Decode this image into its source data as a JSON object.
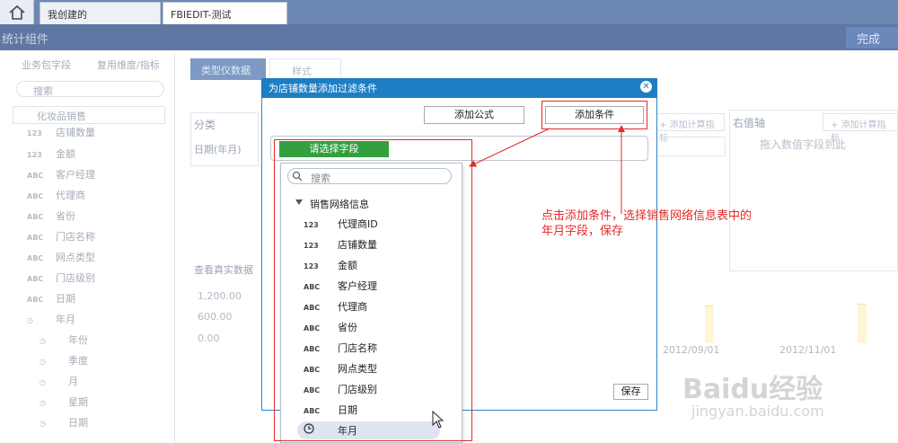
{
  "tabs": {
    "home_icon": "home-icon",
    "tab1": "我创建的",
    "tab2": "FBIEDIT-测试"
  },
  "header": {
    "title": "统计组件",
    "done": "完成"
  },
  "left_panel": {
    "tab_business": "业务包字段",
    "tab_reuse": "复用维度/指标",
    "search_placeholder": "搜索",
    "package": "化妆品销售",
    "fields": [
      {
        "type": "123",
        "label": "店铺数量"
      },
      {
        "type": "123",
        "label": "金额"
      },
      {
        "type": "ABC",
        "label": "客户经理"
      },
      {
        "type": "ABC",
        "label": "代理商"
      },
      {
        "type": "ABC",
        "label": "省份"
      },
      {
        "type": "ABC",
        "label": "门店名称"
      },
      {
        "type": "ABC",
        "label": "网点类型"
      },
      {
        "type": "ABC",
        "label": "门店级别"
      },
      {
        "type": "ABC",
        "label": "日期"
      },
      {
        "type": "clock",
        "label": "年月"
      }
    ],
    "date_children": [
      "年份",
      "季度",
      "月",
      "星期",
      "日期"
    ]
  },
  "main": {
    "tab_type": "类型仪数据",
    "tab_style": "样式",
    "category_label": "分类",
    "date_field": "日期(年月)",
    "check_label": "查看真实数据",
    "y_ticks": [
      "1,200.00",
      "600.00",
      "0.00"
    ],
    "x_ticks": [
      "2012/09/01",
      "2012/11/01"
    ],
    "right_axis_label": "右值轴",
    "right_axis_btn": "+ 添加计算指标",
    "mid_btn": "+ 添加计算指标",
    "drop_hint": "拖入数值字段到此"
  },
  "dialog": {
    "title": "为店铺数量添加过滤条件",
    "add_formula": "添加公式",
    "add_condition": "添加条件",
    "select_field": "请选择字段",
    "save": "保存",
    "search_placeholder": "搜索",
    "group": "销售网络信息",
    "fields": [
      {
        "type": "123",
        "label": "代理商ID"
      },
      {
        "type": "123",
        "label": "店铺数量"
      },
      {
        "type": "123",
        "label": "金额"
      },
      {
        "type": "ABC",
        "label": "客户经理"
      },
      {
        "type": "ABC",
        "label": "代理商"
      },
      {
        "type": "ABC",
        "label": "省份"
      },
      {
        "type": "ABC",
        "label": "门店名称"
      },
      {
        "type": "ABC",
        "label": "网点类型"
      },
      {
        "type": "ABC",
        "label": "门店级别"
      },
      {
        "type": "ABC",
        "label": "日期"
      },
      {
        "type": "clock",
        "label": "年月"
      }
    ]
  },
  "annotation": {
    "line1": "点击添加条件，选择销售网络信息表中的",
    "line2": "年月字段，保存"
  },
  "watermark": {
    "brand": "Baidu经验",
    "url": "jingyan.baidu.com"
  },
  "colors": {
    "dialog_bar": "#1e7ec4",
    "select_btn": "#33a03f",
    "annotation": "#e5292a"
  }
}
